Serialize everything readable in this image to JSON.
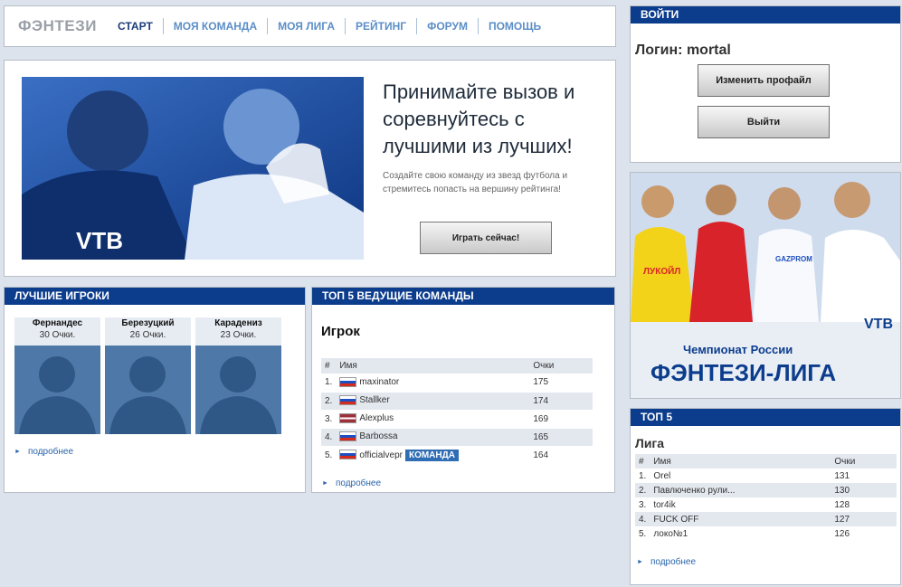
{
  "nav": {
    "logo": "ФЭНТЕЗИ",
    "items": [
      "СТАРТ",
      "МОЯ КОМАНДА",
      "МОЯ ЛИГА",
      "РЕЙТИНГ",
      "ФОРУМ",
      "ПОМОЩЬ"
    ]
  },
  "hero": {
    "title": "Принимайте вызов и соревнуйтесь с лучшими из лучших!",
    "subtitle": "Создайте свою команду из звезд футбола и стремитесь попасть на вершину рейтинга!",
    "button": "Играть сейчас!",
    "photo_text": "VTB"
  },
  "best_players": {
    "header": "ЛУЧШИЕ ИГРОКИ",
    "players": [
      {
        "name": "Фернандес",
        "points": "30 Очки."
      },
      {
        "name": "Березуцкий",
        "points": "26 Очки."
      },
      {
        "name": "Карадениз",
        "points": "23 Очки."
      }
    ],
    "more": "подробнее"
  },
  "top5_teams": {
    "header": "ТОП 5 ВЕДУЩИЕ КОМАНДЫ",
    "subheader": "Игрок",
    "columns": [
      "#",
      "Имя",
      "Очки"
    ],
    "rows": [
      {
        "rank": "1.",
        "flag": "ru",
        "name": "maxinator",
        "points": "175",
        "badge": ""
      },
      {
        "rank": "2.",
        "flag": "ru",
        "name": "Stallker",
        "points": "174",
        "badge": ""
      },
      {
        "rank": "3.",
        "flag": "lv",
        "name": "Alexplus",
        "points": "169",
        "badge": ""
      },
      {
        "rank": "4.",
        "flag": "ru",
        "name": "Barbossa",
        "points": "165",
        "badge": ""
      },
      {
        "rank": "5.",
        "flag": "ru",
        "name": "officialvepr",
        "points": "164",
        "badge": "КОМАНДА"
      }
    ],
    "more": "подробнее"
  },
  "login": {
    "header": "ВОЙТИ",
    "user": "Логин: mortal",
    "edit_button": "Изменить профайл",
    "logout_button": "Выйти"
  },
  "banner": {
    "line1": "Чемпионат России",
    "line2": "ФЭНТЕЗИ-ЛИГА",
    "sponsors": [
      "ЛУКОЙЛ",
      "GAZPROM",
      "VTB"
    ]
  },
  "top5_league": {
    "header": "ТОП 5",
    "subheader": "Лига",
    "columns": [
      "#",
      "Имя",
      "Очки"
    ],
    "rows": [
      {
        "rank": "1.",
        "name": "Orel",
        "points": "131"
      },
      {
        "rank": "2.",
        "name": "Павлюченко рули...",
        "points": "130"
      },
      {
        "rank": "3.",
        "name": "tor4ik",
        "points": "128"
      },
      {
        "rank": "4.",
        "name": "FUCK OFF",
        "points": "127"
      },
      {
        "rank": "5.",
        "name": "локо№1",
        "points": "126"
      }
    ],
    "more": "подробнее"
  },
  "colors": {
    "accent": "#0c3d8d",
    "link": "#2a64aa",
    "background": "#dde3ec"
  }
}
